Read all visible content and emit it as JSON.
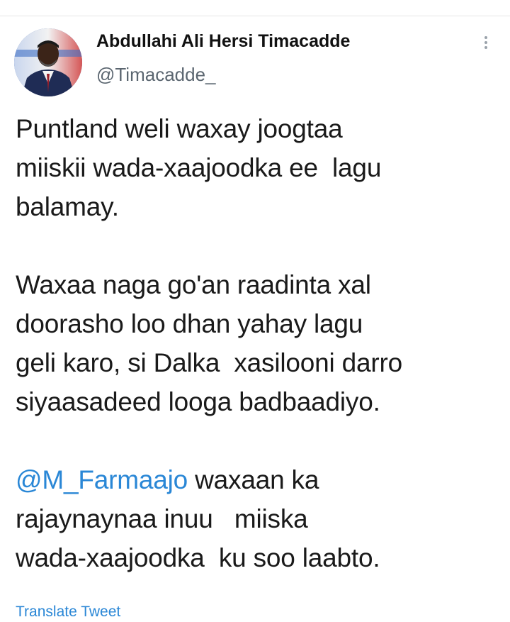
{
  "tweet": {
    "author_name": "Abdullahi Ali Hersi Timacadde",
    "author_handle": "@Timacadde_",
    "paragraph1": {
      "line1": "Puntland weli waxay joogtaa",
      "line2": "miiskii wada-xaajoodka ee  lagu",
      "line3": "balamay."
    },
    "paragraph2": {
      "line1": "Waxaa naga go'an raadinta xal",
      "line2": "doorasho loo dhan yahay lagu",
      "line3": "geli karo, si Dalka  xasilooni darro",
      "line4": "siyaasadeed looga badbaadiyo."
    },
    "paragraph3": {
      "mention": "@M_Farmaajo",
      "line1_rest": " waxaan ka",
      "line2": "rajaynaynaa inuu   miiska",
      "line3": "wada-xaajoodka  ku soo laabto."
    },
    "translate_label": "Translate Tweet"
  },
  "icons": {
    "more": "more-vertical-icon",
    "avatar": "profile-photo"
  },
  "colors": {
    "link": "#2a87d6",
    "handle": "#5b6670",
    "text": "#1a1a1a"
  }
}
